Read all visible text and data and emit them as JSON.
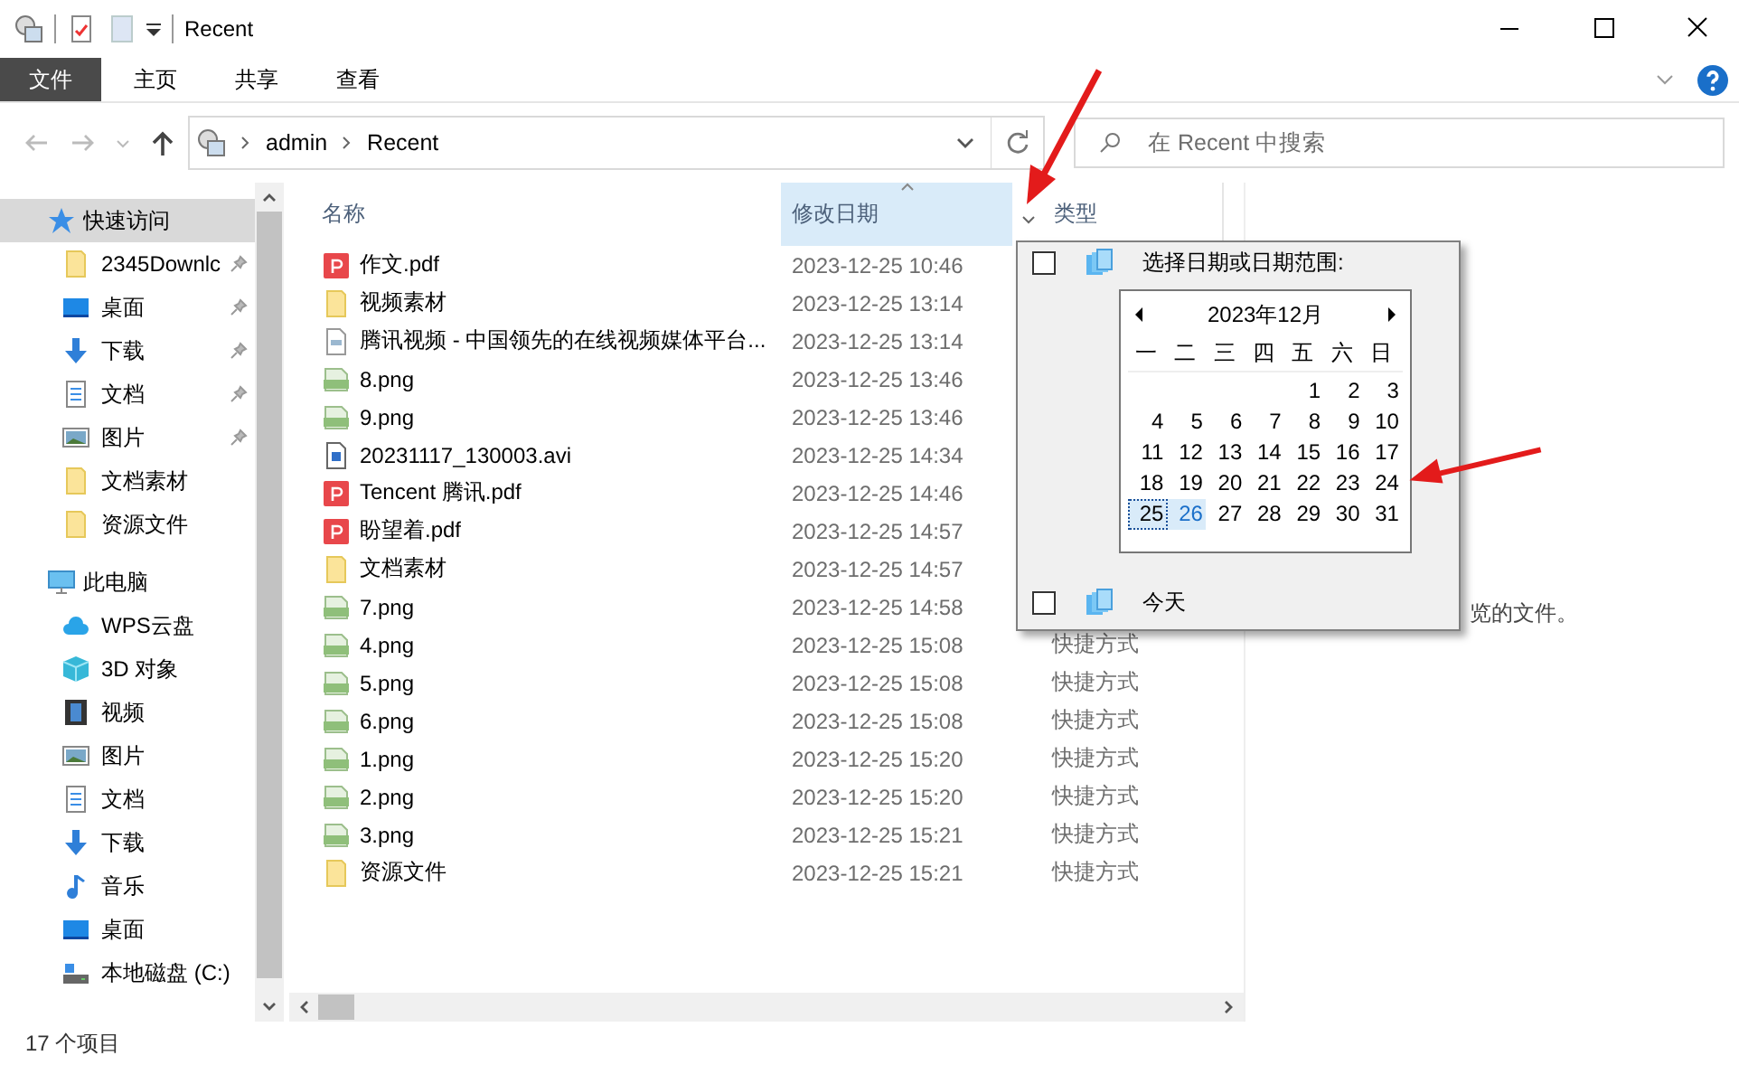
{
  "window": {
    "title": "Recent"
  },
  "ribbon_tabs": [
    {
      "label": "文件",
      "selected": true
    },
    {
      "label": "主页",
      "selected": false
    },
    {
      "label": "共享",
      "selected": false
    },
    {
      "label": "查看",
      "selected": false
    }
  ],
  "address": {
    "crumbs": [
      "admin",
      "Recent"
    ]
  },
  "search": {
    "placeholder": "在 Recent 中搜索"
  },
  "sidebar": {
    "items": [
      {
        "label": "快速访问",
        "kind": "star",
        "pinned": false,
        "selected": true,
        "children": [
          {
            "label": "2345Downlc",
            "kind": "folder",
            "pinned": true,
            "selected": false
          },
          {
            "label": "桌面",
            "kind": "desktop",
            "pinned": true,
            "selected": false
          },
          {
            "label": "下载",
            "kind": "download",
            "pinned": true,
            "selected": false
          },
          {
            "label": "文档",
            "kind": "doc",
            "pinned": true,
            "selected": false
          },
          {
            "label": "图片",
            "kind": "picture",
            "pinned": true,
            "selected": false
          },
          {
            "label": "文档素材",
            "kind": "folder",
            "pinned": false,
            "selected": false
          },
          {
            "label": "资源文件",
            "kind": "folder",
            "pinned": false,
            "selected": false
          }
        ]
      },
      {
        "label": "此电脑",
        "kind": "pc",
        "pinned": false,
        "selected": false,
        "children": [
          {
            "label": "WPS云盘",
            "kind": "cloud",
            "pinned": false,
            "selected": false
          },
          {
            "label": "3D 对象",
            "kind": "cube",
            "pinned": false,
            "selected": false
          },
          {
            "label": "视频",
            "kind": "video",
            "pinned": false,
            "selected": false
          },
          {
            "label": "图片",
            "kind": "picture",
            "pinned": false,
            "selected": false
          },
          {
            "label": "文档",
            "kind": "doc",
            "pinned": false,
            "selected": false
          },
          {
            "label": "下载",
            "kind": "download",
            "pinned": false,
            "selected": false
          },
          {
            "label": "音乐",
            "kind": "music",
            "pinned": false,
            "selected": false
          },
          {
            "label": "桌面",
            "kind": "desktop",
            "pinned": false,
            "selected": false
          },
          {
            "label": "本地磁盘 (C:)",
            "kind": "drive",
            "pinned": false,
            "selected": false
          }
        ]
      }
    ]
  },
  "table": {
    "columns": [
      {
        "label": "名称",
        "sorted": false
      },
      {
        "label": "修改日期",
        "sorted": true
      },
      {
        "label": "类型",
        "sorted": false
      }
    ],
    "rows": [
      {
        "name": "作文.pdf",
        "kind": "pdf",
        "date": "2023-12-25 10:46"
      },
      {
        "name": "视频素材",
        "kind": "folder",
        "date": "2023-12-25 13:14"
      },
      {
        "name": "腾讯视频 - 中国领先的在线视频媒体平台...",
        "kind": "ts",
        "date": "2023-12-25 13:14"
      },
      {
        "name": "8.png",
        "kind": "png",
        "date": "2023-12-25 13:46"
      },
      {
        "name": "9.png",
        "kind": "png",
        "date": "2023-12-25 13:46"
      },
      {
        "name": "20231117_130003.avi",
        "kind": "avi",
        "date": "2023-12-25 14:34"
      },
      {
        "name": "Tencent 腾讯.pdf",
        "kind": "pdf",
        "date": "2023-12-25 14:46"
      },
      {
        "name": "盼望着.pdf",
        "kind": "pdf",
        "date": "2023-12-25 14:57"
      },
      {
        "name": "文档素材",
        "kind": "folder",
        "date": "2023-12-25 14:57"
      },
      {
        "name": "7.png",
        "kind": "png",
        "date": "2023-12-25 14:58"
      },
      {
        "name": "4.png",
        "kind": "png",
        "date": "2023-12-25 15:08",
        "type": "快捷方式"
      },
      {
        "name": "5.png",
        "kind": "png",
        "date": "2023-12-25 15:08",
        "type": "快捷方式"
      },
      {
        "name": "6.png",
        "kind": "png",
        "date": "2023-12-25 15:08",
        "type": "快捷方式"
      },
      {
        "name": "1.png",
        "kind": "png",
        "date": "2023-12-25 15:20",
        "type": "快捷方式"
      },
      {
        "name": "2.png",
        "kind": "png",
        "date": "2023-12-25 15:20",
        "type": "快捷方式"
      },
      {
        "name": "3.png",
        "kind": "png",
        "date": "2023-12-25 15:21",
        "type": "快捷方式"
      },
      {
        "name": "资源文件",
        "kind": "folder",
        "date": "2023-12-25 15:21",
        "type": "快捷方式"
      }
    ]
  },
  "preview_pane": {
    "message": "览的文件。"
  },
  "date_filter": {
    "range_label": "选择日期或日期范围:",
    "range_checked": false,
    "today_label": "今天",
    "today_checked": false,
    "calendar": {
      "month": "2023年12月",
      "weekdays": [
        "一",
        "二",
        "三",
        "四",
        "五",
        "六",
        "日"
      ],
      "weeks": [
        [
          {
            "day": "1",
            "today": false,
            "hover": false
          },
          {
            "day": "2",
            "today": false,
            "hover": false
          },
          {
            "day": "3",
            "today": false,
            "hover": false
          }
        ],
        [
          {
            "day": "4",
            "today": false,
            "hover": false
          },
          {
            "day": "5",
            "today": false,
            "hover": false
          },
          {
            "day": "6",
            "today": false,
            "hover": false
          },
          {
            "day": "7",
            "today": false,
            "hover": false
          },
          {
            "day": "8",
            "today": false,
            "hover": false
          },
          {
            "day": "9",
            "today": false,
            "hover": false
          },
          {
            "day": "10",
            "today": false,
            "hover": false
          }
        ],
        [
          {
            "day": "11",
            "today": false,
            "hover": false
          },
          {
            "day": "12",
            "today": false,
            "hover": false
          },
          {
            "day": "13",
            "today": false,
            "hover": false
          },
          {
            "day": "14",
            "today": false,
            "hover": false
          },
          {
            "day": "15",
            "today": false,
            "hover": false
          },
          {
            "day": "16",
            "today": false,
            "hover": false
          },
          {
            "day": "17",
            "today": false,
            "hover": false
          }
        ],
        [
          {
            "day": "18",
            "today": false,
            "hover": false
          },
          {
            "day": "19",
            "today": false,
            "hover": false
          },
          {
            "day": "20",
            "today": false,
            "hover": false
          },
          {
            "day": "21",
            "today": false,
            "hover": false
          },
          {
            "day": "22",
            "today": false,
            "hover": false
          },
          {
            "day": "23",
            "today": false,
            "hover": false
          },
          {
            "day": "24",
            "today": false,
            "hover": false
          }
        ],
        [
          {
            "day": "25",
            "today": true,
            "hover": false
          },
          {
            "day": "26",
            "today": false,
            "hover": true
          },
          {
            "day": "27",
            "today": false,
            "hover": false
          },
          {
            "day": "28",
            "today": false,
            "hover": false
          },
          {
            "day": "29",
            "today": false,
            "hover": false
          },
          {
            "day": "30",
            "today": false,
            "hover": false
          },
          {
            "day": "31",
            "today": false,
            "hover": false
          }
        ]
      ]
    }
  },
  "status_bar": {
    "item_count": "17 个项目"
  }
}
